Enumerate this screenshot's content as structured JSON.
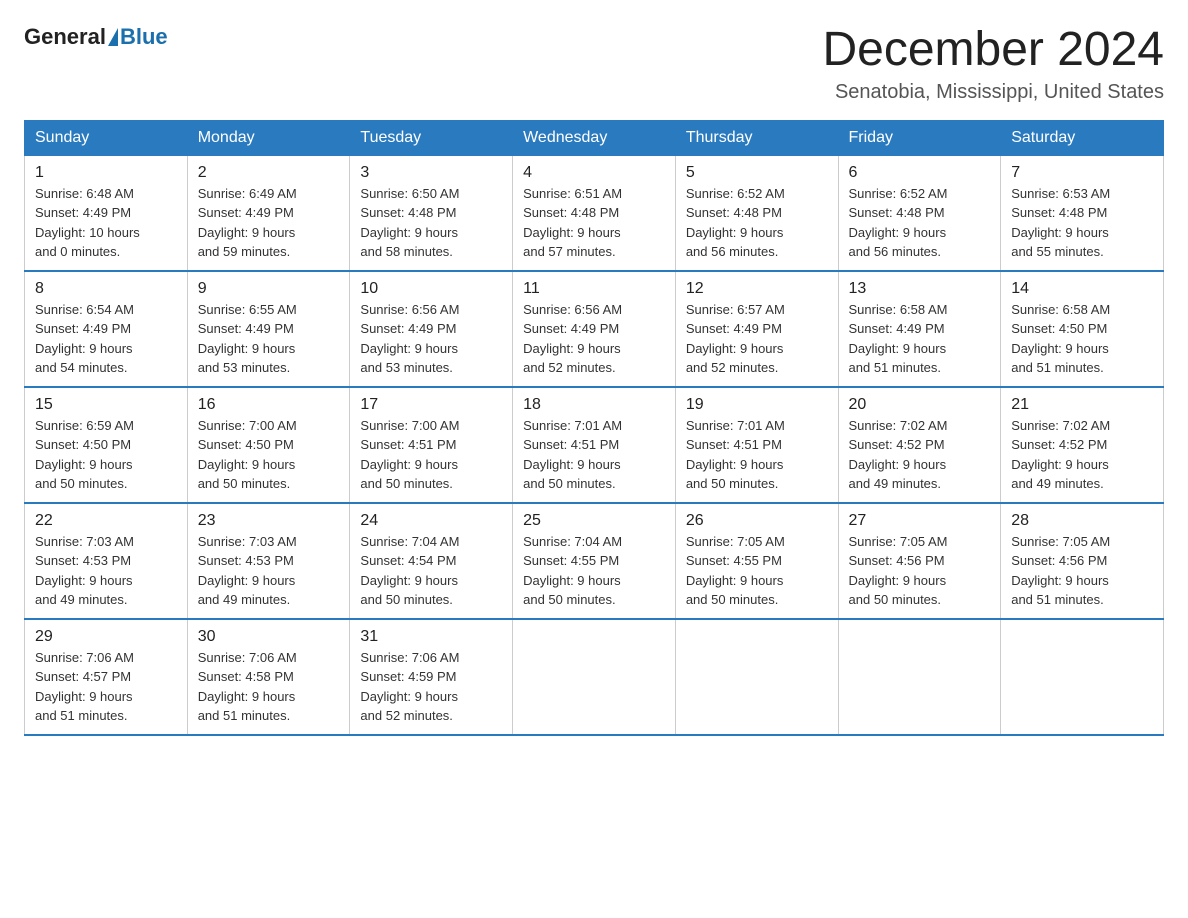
{
  "logo": {
    "general": "General",
    "blue": "Blue"
  },
  "title": "December 2024",
  "location": "Senatobia, Mississippi, United States",
  "days_of_week": [
    "Sunday",
    "Monday",
    "Tuesday",
    "Wednesday",
    "Thursday",
    "Friday",
    "Saturday"
  ],
  "weeks": [
    [
      {
        "day": "1",
        "sunrise": "6:48 AM",
        "sunset": "4:49 PM",
        "daylight": "10 hours and 0 minutes."
      },
      {
        "day": "2",
        "sunrise": "6:49 AM",
        "sunset": "4:49 PM",
        "daylight": "9 hours and 59 minutes."
      },
      {
        "day": "3",
        "sunrise": "6:50 AM",
        "sunset": "4:48 PM",
        "daylight": "9 hours and 58 minutes."
      },
      {
        "day": "4",
        "sunrise": "6:51 AM",
        "sunset": "4:48 PM",
        "daylight": "9 hours and 57 minutes."
      },
      {
        "day": "5",
        "sunrise": "6:52 AM",
        "sunset": "4:48 PM",
        "daylight": "9 hours and 56 minutes."
      },
      {
        "day": "6",
        "sunrise": "6:52 AM",
        "sunset": "4:48 PM",
        "daylight": "9 hours and 56 minutes."
      },
      {
        "day": "7",
        "sunrise": "6:53 AM",
        "sunset": "4:48 PM",
        "daylight": "9 hours and 55 minutes."
      }
    ],
    [
      {
        "day": "8",
        "sunrise": "6:54 AM",
        "sunset": "4:49 PM",
        "daylight": "9 hours and 54 minutes."
      },
      {
        "day": "9",
        "sunrise": "6:55 AM",
        "sunset": "4:49 PM",
        "daylight": "9 hours and 53 minutes."
      },
      {
        "day": "10",
        "sunrise": "6:56 AM",
        "sunset": "4:49 PM",
        "daylight": "9 hours and 53 minutes."
      },
      {
        "day": "11",
        "sunrise": "6:56 AM",
        "sunset": "4:49 PM",
        "daylight": "9 hours and 52 minutes."
      },
      {
        "day": "12",
        "sunrise": "6:57 AM",
        "sunset": "4:49 PM",
        "daylight": "9 hours and 52 minutes."
      },
      {
        "day": "13",
        "sunrise": "6:58 AM",
        "sunset": "4:49 PM",
        "daylight": "9 hours and 51 minutes."
      },
      {
        "day": "14",
        "sunrise": "6:58 AM",
        "sunset": "4:50 PM",
        "daylight": "9 hours and 51 minutes."
      }
    ],
    [
      {
        "day": "15",
        "sunrise": "6:59 AM",
        "sunset": "4:50 PM",
        "daylight": "9 hours and 50 minutes."
      },
      {
        "day": "16",
        "sunrise": "7:00 AM",
        "sunset": "4:50 PM",
        "daylight": "9 hours and 50 minutes."
      },
      {
        "day": "17",
        "sunrise": "7:00 AM",
        "sunset": "4:51 PM",
        "daylight": "9 hours and 50 minutes."
      },
      {
        "day": "18",
        "sunrise": "7:01 AM",
        "sunset": "4:51 PM",
        "daylight": "9 hours and 50 minutes."
      },
      {
        "day": "19",
        "sunrise": "7:01 AM",
        "sunset": "4:51 PM",
        "daylight": "9 hours and 50 minutes."
      },
      {
        "day": "20",
        "sunrise": "7:02 AM",
        "sunset": "4:52 PM",
        "daylight": "9 hours and 49 minutes."
      },
      {
        "day": "21",
        "sunrise": "7:02 AM",
        "sunset": "4:52 PM",
        "daylight": "9 hours and 49 minutes."
      }
    ],
    [
      {
        "day": "22",
        "sunrise": "7:03 AM",
        "sunset": "4:53 PM",
        "daylight": "9 hours and 49 minutes."
      },
      {
        "day": "23",
        "sunrise": "7:03 AM",
        "sunset": "4:53 PM",
        "daylight": "9 hours and 49 minutes."
      },
      {
        "day": "24",
        "sunrise": "7:04 AM",
        "sunset": "4:54 PM",
        "daylight": "9 hours and 50 minutes."
      },
      {
        "day": "25",
        "sunrise": "7:04 AM",
        "sunset": "4:55 PM",
        "daylight": "9 hours and 50 minutes."
      },
      {
        "day": "26",
        "sunrise": "7:05 AM",
        "sunset": "4:55 PM",
        "daylight": "9 hours and 50 minutes."
      },
      {
        "day": "27",
        "sunrise": "7:05 AM",
        "sunset": "4:56 PM",
        "daylight": "9 hours and 50 minutes."
      },
      {
        "day": "28",
        "sunrise": "7:05 AM",
        "sunset": "4:56 PM",
        "daylight": "9 hours and 51 minutes."
      }
    ],
    [
      {
        "day": "29",
        "sunrise": "7:06 AM",
        "sunset": "4:57 PM",
        "daylight": "9 hours and 51 minutes."
      },
      {
        "day": "30",
        "sunrise": "7:06 AM",
        "sunset": "4:58 PM",
        "daylight": "9 hours and 51 minutes."
      },
      {
        "day": "31",
        "sunrise": "7:06 AM",
        "sunset": "4:59 PM",
        "daylight": "9 hours and 52 minutes."
      },
      null,
      null,
      null,
      null
    ]
  ],
  "labels": {
    "sunrise": "Sunrise:",
    "sunset": "Sunset:",
    "daylight": "Daylight:"
  }
}
